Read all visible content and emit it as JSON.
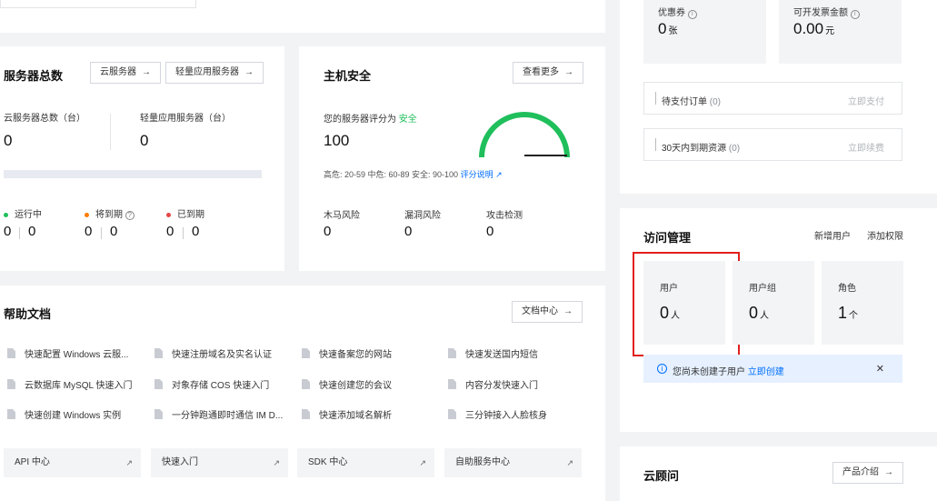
{
  "servers": {
    "title": "服务器总数",
    "btn_cvm": "云服务器",
    "btn_lighthouse": "轻量应用服务器",
    "cvm_label": "云服务器总数（台）",
    "cvm_value": "0",
    "lh_label": "轻量应用服务器（台）",
    "lh_value": "0",
    "status": [
      {
        "label": "运行中",
        "color": "#1fbf5c",
        "a": "0",
        "b": "0"
      },
      {
        "label": "将到期",
        "color": "#ff7d00",
        "a": "0",
        "b": "0"
      },
      {
        "label": "已到期",
        "color": "#e54545",
        "a": "0",
        "b": "0"
      }
    ]
  },
  "security": {
    "title": "主机安全",
    "btn_more": "查看更多",
    "score_label": "您的服务器评分为",
    "score_status": "安全",
    "score": "100",
    "ranges": "高危: 20-59  中危: 60-89  安全: 90-100",
    "explain_link": "评分说明",
    "risks": [
      {
        "label": "木马风险",
        "value": "0"
      },
      {
        "label": "漏洞风险",
        "value": "0"
      },
      {
        "label": "攻击检测",
        "value": "0"
      }
    ]
  },
  "billing": {
    "coupon_label": "优惠券",
    "coupon_value": "0",
    "coupon_unit": "张",
    "invoice_label": "可开发票金额",
    "invoice_value": "0.00",
    "invoice_unit": "元",
    "pending_label": "待支付订单",
    "pending_count": "(0)",
    "pending_action": "立即支付",
    "expiring_label": "30天内到期资源",
    "expiring_count": "(0)",
    "expiring_action": "立即续费"
  },
  "docs": {
    "title": "帮助文档",
    "btn_center": "文档中心",
    "items": [
      "快速配置 Windows 云服...",
      "快速注册域名及实名认证",
      "快速备案您的网站",
      "快速发送国内短信",
      "云数据库 MySQL 快速入门",
      "对象存储 COS 快速入门",
      "快速创建您的会议",
      "内容分发快速入门",
      "快速创建 Windows 实例",
      "一分钟跑通即时通信 IM D...",
      "快速添加域名解析",
      "三分钟接入人脸核身"
    ],
    "links": [
      "API 中心",
      "快速入门",
      "SDK 中心",
      "自助服务中心"
    ]
  },
  "access": {
    "title": "访问管理",
    "add_user": "新增用户",
    "add_perm": "添加权限",
    "stats": [
      {
        "label": "用户",
        "value": "0",
        "unit": "人"
      },
      {
        "label": "用户组",
        "value": "0",
        "unit": "人"
      },
      {
        "label": "角色",
        "value": "1",
        "unit": "个"
      }
    ],
    "notice": "您尚未创建子用户",
    "notice_link": "立即创建",
    "close": "✕"
  },
  "advisor": {
    "title": "云顾问",
    "btn_intro": "产品介绍"
  },
  "colors": {
    "accent": "#006eff",
    "safe": "#1fbf5c",
    "highlight": "#e0201e"
  }
}
